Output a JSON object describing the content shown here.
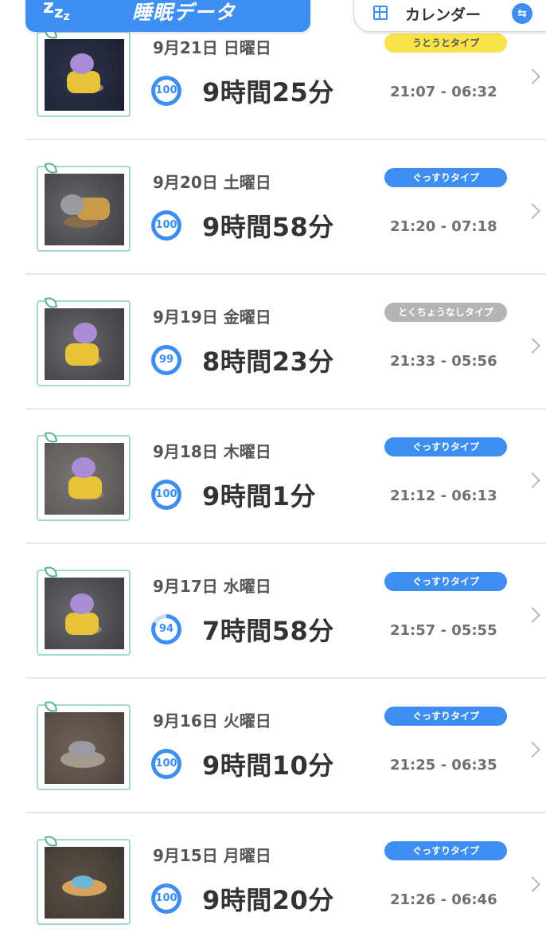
{
  "header": {
    "title": "睡眠データ",
    "zzz_icon": "sleep-zzz-icon",
    "calendar_label": "カレンダー",
    "calendar_icon": "calendar-icon",
    "swap_icon": "swap-icon",
    "accent_color": "#3d8ef0"
  },
  "entries": [
    {
      "date": "9月21日 日曜日",
      "score": "100",
      "duration": "9時間25分",
      "type": "うとうとタイプ",
      "type_color": "yellow",
      "time_range": "21:07 - 06:32"
    },
    {
      "date": "9月20日 土曜日",
      "score": "100",
      "duration": "9時間58分",
      "type": "ぐっすりタイプ",
      "type_color": "blue",
      "time_range": "21:20 - 07:18"
    },
    {
      "date": "9月19日 金曜日",
      "score": "99",
      "duration": "8時間23分",
      "type": "とくちょうなしタイプ",
      "type_color": "gray",
      "time_range": "21:33 - 05:56"
    },
    {
      "date": "9月18日 木曜日",
      "score": "100",
      "duration": "9時間1分",
      "type": "ぐっすりタイプ",
      "type_color": "blue",
      "time_range": "21:12 - 06:13"
    },
    {
      "date": "9月17日 水曜日",
      "score": "94",
      "duration": "7時間58分",
      "type": "ぐっすりタイプ",
      "type_color": "blue",
      "time_range": "21:57 - 05:55"
    },
    {
      "date": "9月16日 火曜日",
      "score": "100",
      "duration": "9時間10分",
      "type": "ぐっすりタイプ",
      "type_color": "blue",
      "time_range": "21:25 - 06:35"
    },
    {
      "date": "9月15日 月曜日",
      "score": "100",
      "duration": "9時間20分",
      "type": "ぐっすりタイプ",
      "type_color": "blue",
      "time_range": "21:26 - 06:46"
    }
  ]
}
